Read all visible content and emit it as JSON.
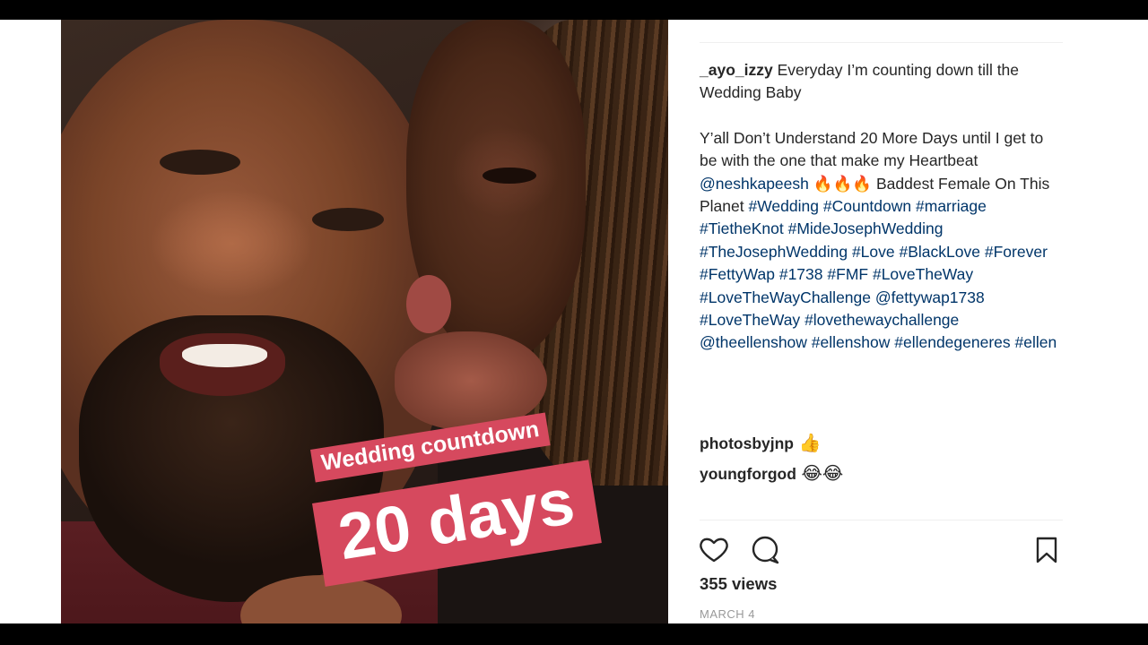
{
  "post": {
    "username": "_ayo_izzy",
    "caption_line1": " Everyday I’m counting down till the Wedding Baby",
    "caption_line2": "Y’all Don’t Understand 20 More Days until I get to be with the one that make my Heartbeat",
    "mention1": "@neshkapeesh",
    "fire_emojis": " 🔥🔥🔥 ",
    "caption_line3": "Baddest Female On This Planet ",
    "hashtags_a": [
      "#Wedding",
      "#Countdown",
      "#marriage",
      "#TietheKnot",
      "#MideJosephWedding",
      "#TheJosephWedding",
      "#Love",
      "#BlackLove",
      "#Forever",
      "#FettyWap",
      "#1738",
      "#FMF",
      "#LoveTheWay",
      "#LoveTheWayChallenge"
    ],
    "mention2": "@fettywap1738",
    "hashtags_b": [
      "#LoveTheWay",
      "#lovethewaychallenge"
    ],
    "mention3": "@theellenshow",
    "hashtags_c": [
      "#ellenshow",
      "#ellendegeneres",
      "#ellen"
    ]
  },
  "comments": [
    {
      "user": "photosbyjnp",
      "text": " 👍"
    },
    {
      "user": "youngforgod",
      "text": " 😂😂"
    }
  ],
  "actions": {
    "like_icon": "heart-icon",
    "comment_icon": "comment-icon",
    "save_icon": "bookmark-icon"
  },
  "stats": {
    "views": "355 views",
    "date": "MARCH 4"
  },
  "story_sticker": {
    "small_text": "Wedding countdown",
    "big_text": "20 days",
    "color": "#d6495e"
  },
  "colors": {
    "link": "#003569",
    "text": "#262626",
    "muted": "#999999"
  }
}
